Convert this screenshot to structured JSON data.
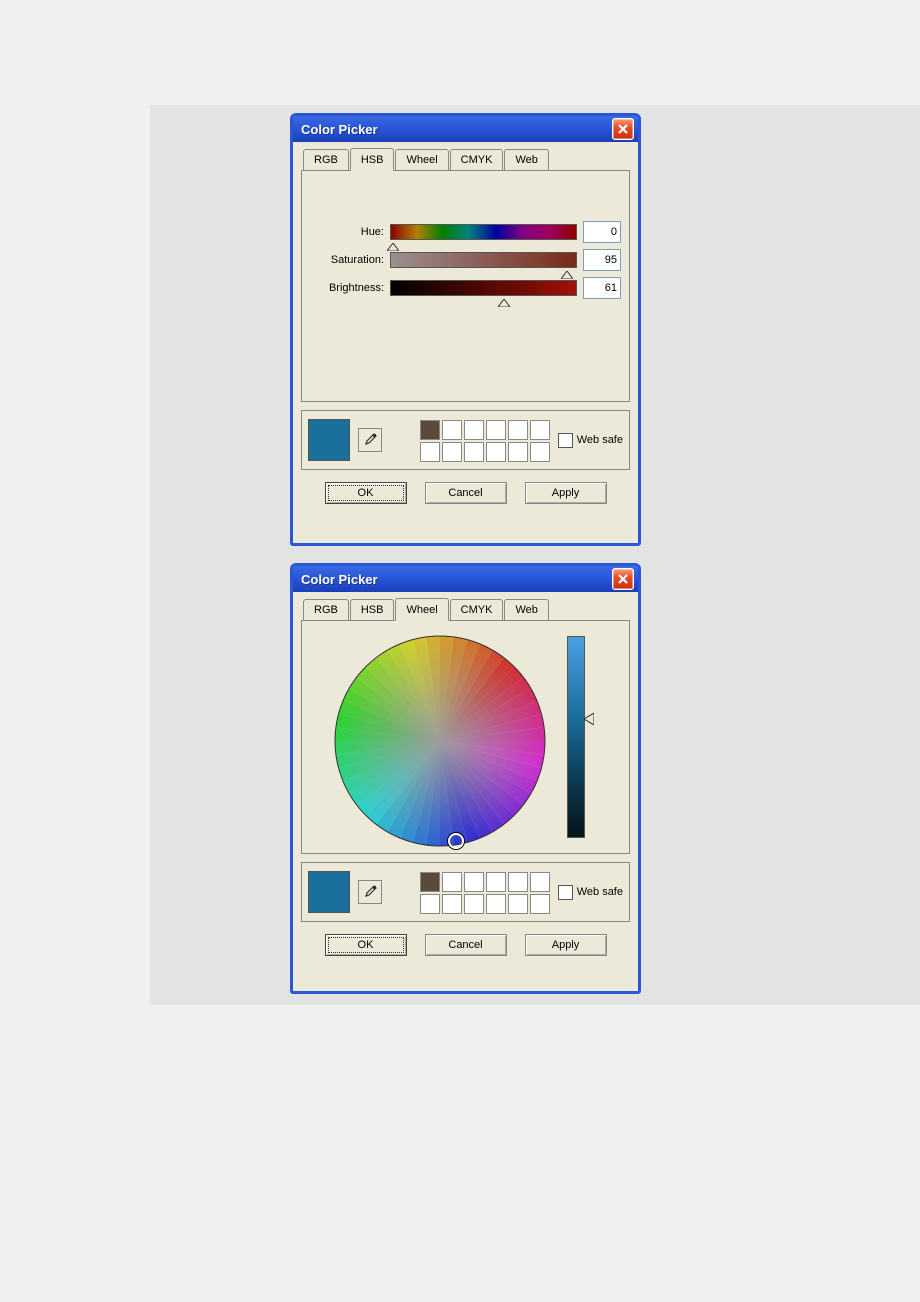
{
  "dialog_title": "Color Picker",
  "tabs": {
    "rgb": "RGB",
    "hsb": "HSB",
    "wheel": "Wheel",
    "cmyk": "CMYK",
    "web": "Web"
  },
  "hsb": {
    "hue_label": "Hue:",
    "sat_label": "Saturation:",
    "bri_label": "Brightness:",
    "hue_value": "0",
    "sat_value": "95",
    "bri_value": "61"
  },
  "websafe_label": "Web safe",
  "buttons": {
    "ok": "OK",
    "cancel": "Cancel",
    "apply": "Apply"
  },
  "selected_color": "#1a6f9c",
  "palette_filled_index": 0
}
